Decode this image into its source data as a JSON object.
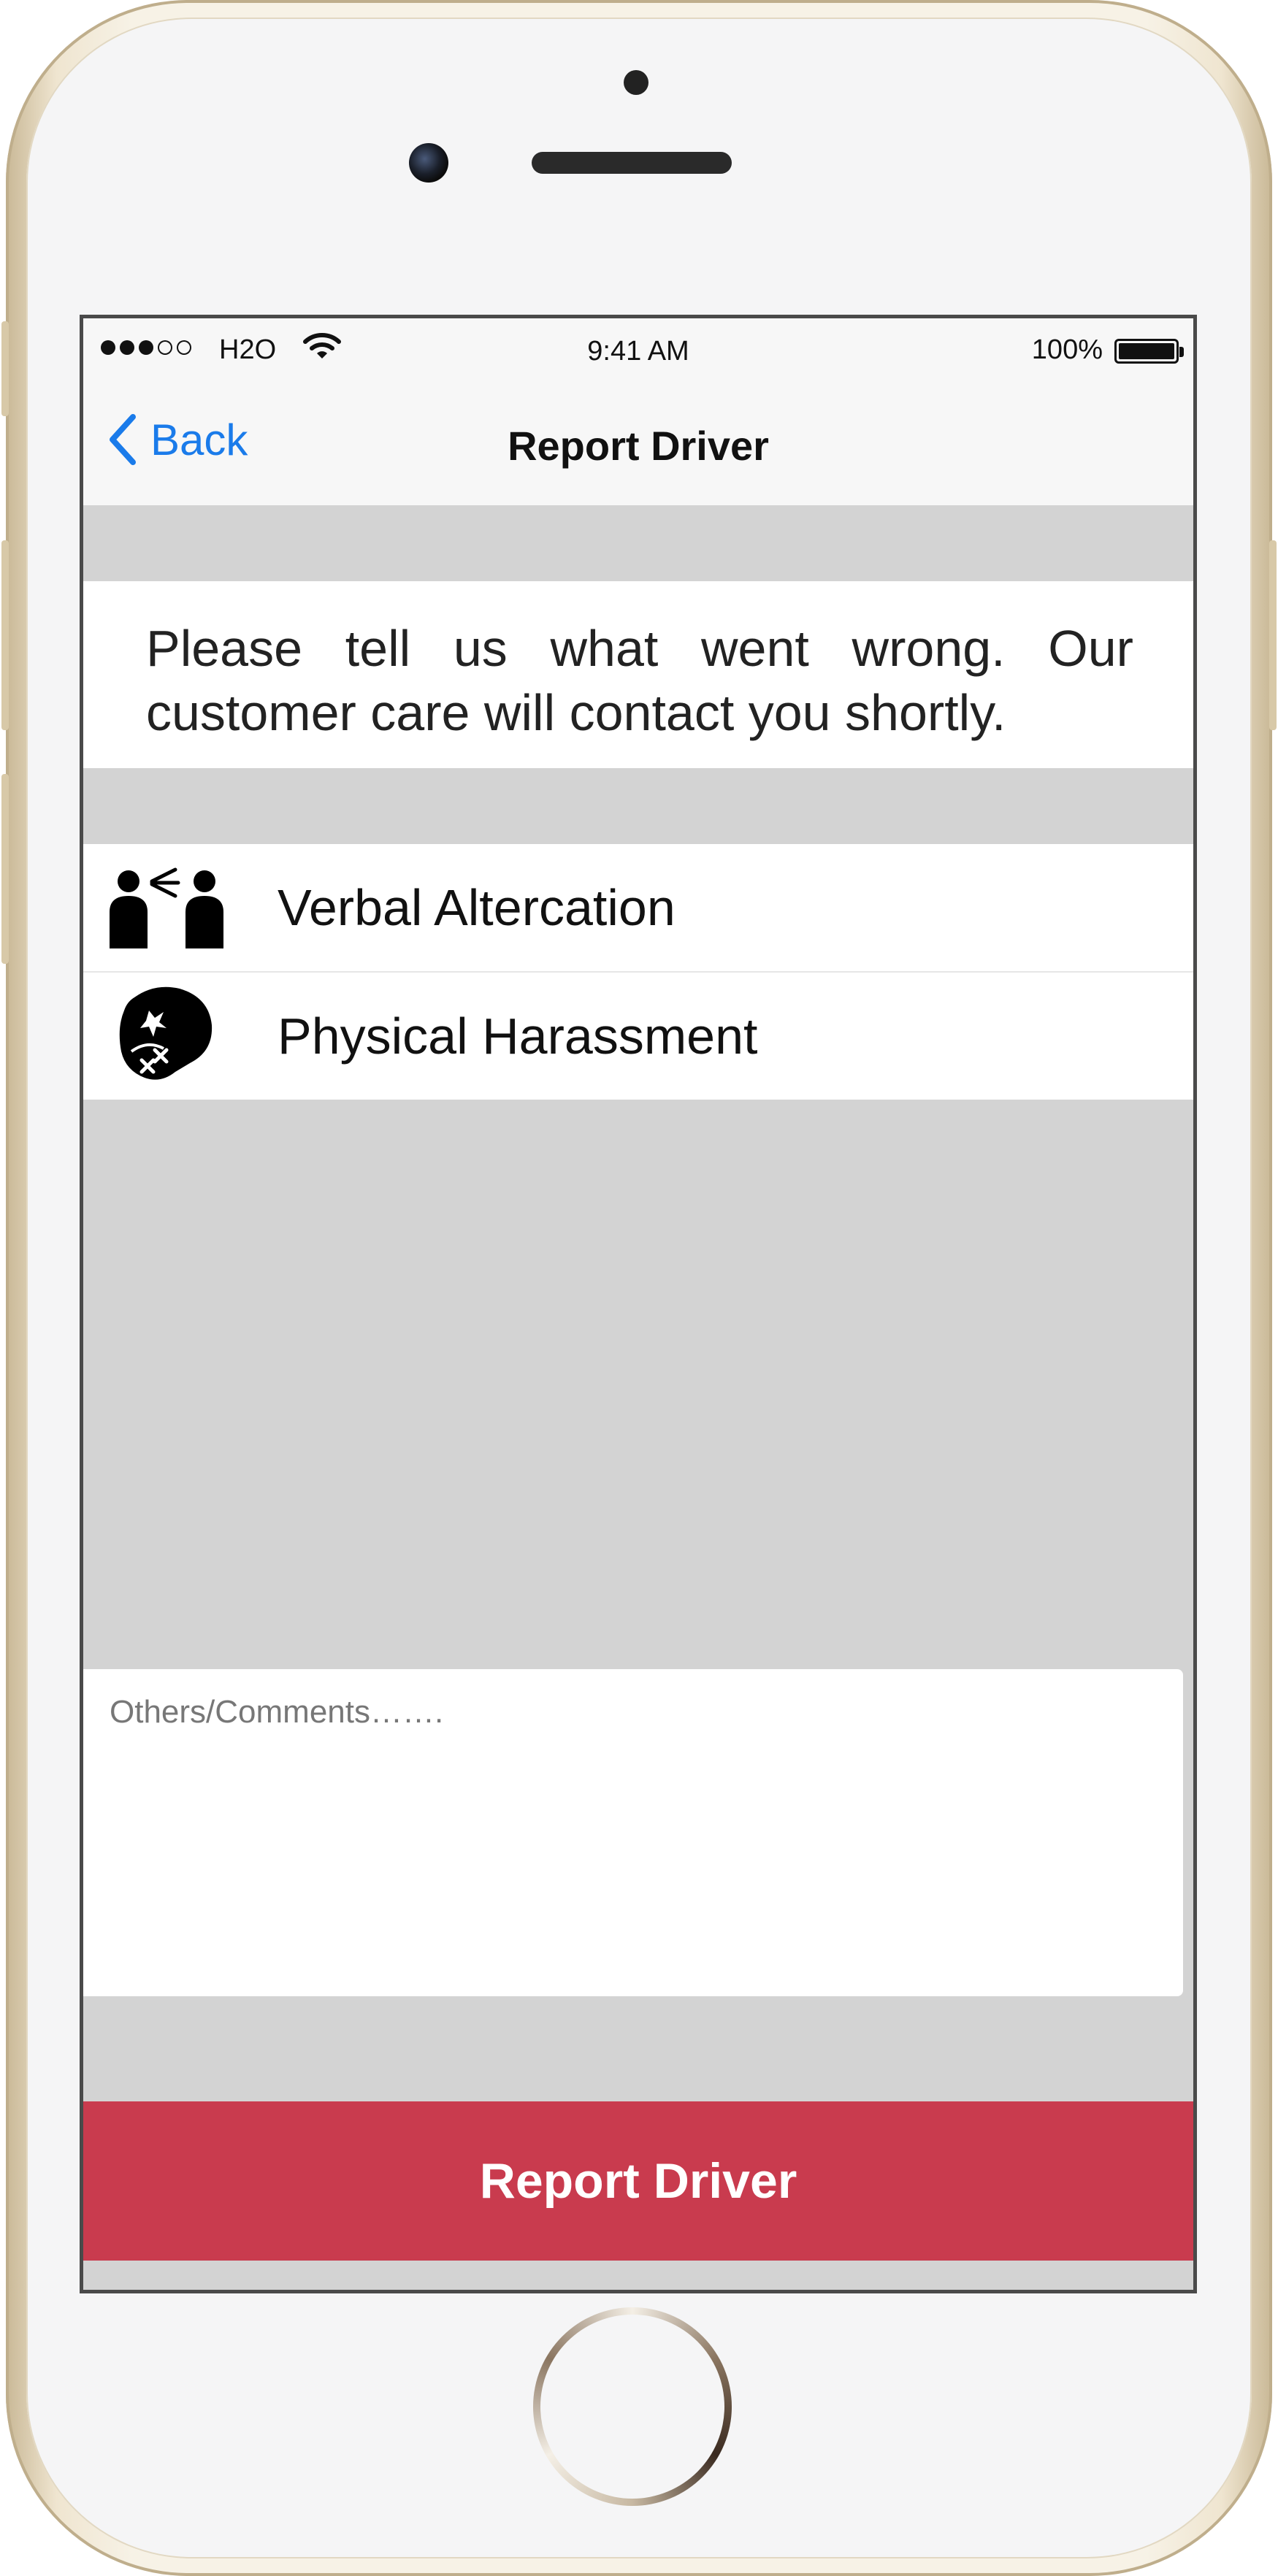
{
  "status_bar": {
    "carrier": "H2O",
    "time": "9:41 AM",
    "battery_percent": "100%",
    "signal_bars_filled": 3,
    "signal_bars_total": 5
  },
  "nav": {
    "back_label": "Back",
    "title": "Report Driver"
  },
  "info": {
    "text": "Please tell us what went wrong. Our customer care will contact you shortly."
  },
  "options": [
    {
      "label": "Verbal Altercation",
      "icon": "verbal-altercation-icon"
    },
    {
      "label": "Physical Harassment",
      "icon": "boxing-glove-icon"
    }
  ],
  "comments": {
    "placeholder": "Others/Comments……."
  },
  "report_button": {
    "label": "Report Driver"
  },
  "colors": {
    "accent_blue": "#1a7bea",
    "report_red": "#c93b4e",
    "background_gray": "#d3d3d3"
  }
}
